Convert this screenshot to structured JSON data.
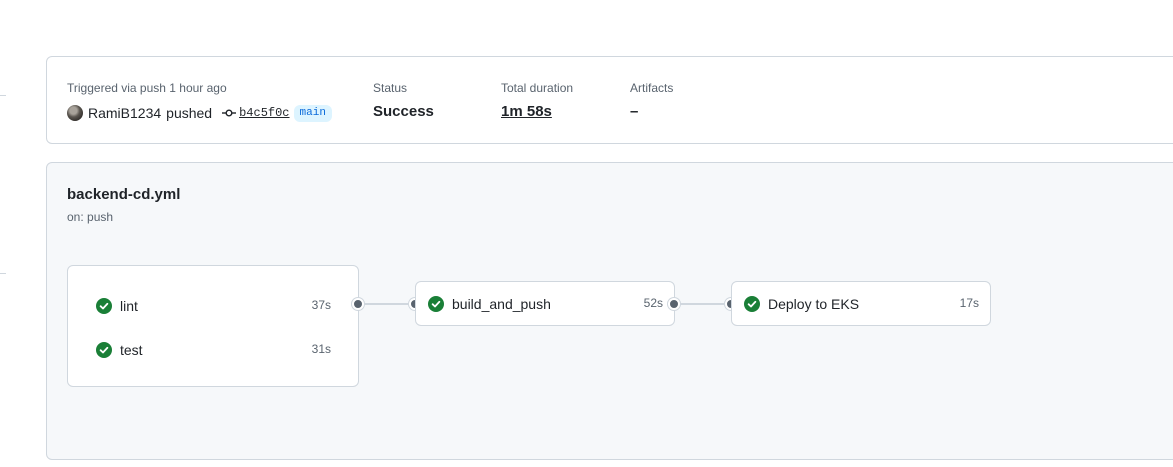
{
  "summary": {
    "trigger_text": "Triggered via push 1 hour ago",
    "actor_name": "RamiB1234",
    "action_text": "pushed",
    "commit_sha": "b4c5f0c",
    "branch": "main",
    "status_label": "Status",
    "status_value": "Success",
    "duration_label": "Total duration",
    "duration_value": "1m 58s",
    "artifacts_label": "Artifacts",
    "artifacts_value": "–"
  },
  "workflow": {
    "file_name": "backend-cd.yml",
    "trigger": "on: push",
    "groups": [
      {
        "jobs": [
          {
            "name": "lint",
            "duration": "37s",
            "status": "success"
          },
          {
            "name": "test",
            "duration": "31s",
            "status": "success"
          }
        ]
      },
      {
        "jobs": [
          {
            "name": "build_and_push",
            "duration": "52s",
            "status": "success"
          }
        ]
      },
      {
        "jobs": [
          {
            "name": "Deploy to EKS",
            "duration": "17s",
            "status": "success"
          }
        ]
      }
    ]
  },
  "icons": {
    "success": "check-circle-fill-icon",
    "commit": "git-commit-icon",
    "avatar": "avatar"
  },
  "colors": {
    "success": "#1a7f37",
    "branch_text": "#0969da",
    "branch_bg": "#ddf4ff",
    "card_bg": "#f6f8fa",
    "border": "#d0d7de",
    "muted_text": "#59636e"
  }
}
